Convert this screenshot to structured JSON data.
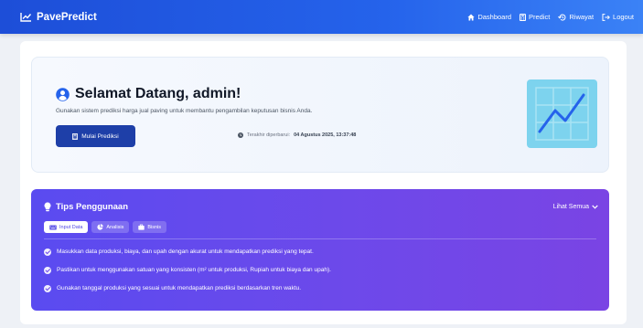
{
  "navbar": {
    "brand": "PavePredict",
    "links": [
      {
        "label": "Dashboard",
        "icon": "home-icon"
      },
      {
        "label": "Predict",
        "icon": "calculator-icon"
      },
      {
        "label": "Riwayat",
        "icon": "history-icon"
      },
      {
        "label": "Logout",
        "icon": "logout-icon"
      }
    ]
  },
  "welcome": {
    "title": "Selamat Datang, admin!",
    "subtitle": "Gunakan sistem prediksi harga jual paving untuk membantu pengambilan keputusan bisnis Anda.",
    "button_label": "Mulai Prediksi",
    "last_login_label": "Terakhir diperbarui:",
    "last_login_value": "04 Agustus 2025, 13:37:48"
  },
  "tips": {
    "title": "Tips Penggunaan",
    "see_all": "Lihat Semua",
    "tabs": [
      "Input Data",
      "Analisis",
      "Bisnis"
    ],
    "active_tab": "Input Data",
    "items": [
      "Masukkan data produksi, biaya, dan upah dengan akurat untuk mendapatkan prediksi yang tepat.",
      "Pastikan untuk menggunakan satuan yang konsisten (m² untuk produksi, Rupiah untuk biaya dan upah).",
      "Gunakan tanggal produksi yang sesuai untuk mendapatkan prediksi berdasarkan tren waktu."
    ]
  },
  "colors": {
    "navbar": "#2563eb",
    "primary_button": "#1e3fa8",
    "tips_gradient_start": "#5a4bf0",
    "tips_gradient_end": "#7a44e4",
    "illustration": "#7dd3ee"
  }
}
